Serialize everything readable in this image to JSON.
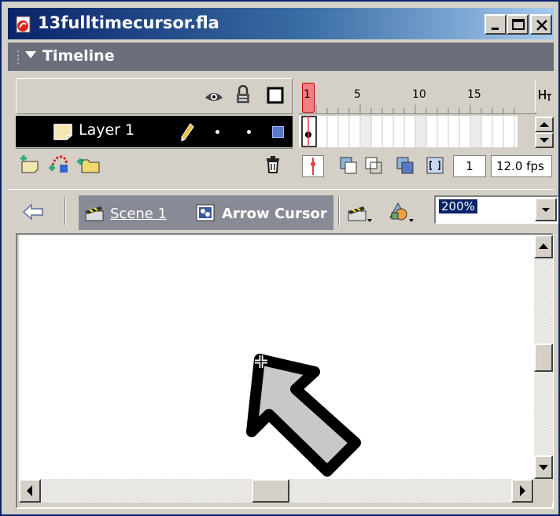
{
  "window": {
    "title": "13fulltimecursor.fla",
    "buttons": [
      "minimize",
      "maximize",
      "close"
    ]
  },
  "timeline": {
    "panel_title": "Timeline",
    "ruler_numbers": [
      "1",
      "5",
      "10",
      "15"
    ],
    "layer": {
      "name": "Layer 1"
    },
    "current_frame": "1",
    "frame_rate": "12.0 fps"
  },
  "editbar": {
    "scene_label": "Scene 1",
    "symbol_label": "Arrow Cursor",
    "zoom": "200%"
  },
  "colors": {
    "titlebar_start": "#0a246a",
    "panel_header": "#6b6f7c",
    "playhead": "#e04040",
    "layer_row_bg": "#000000",
    "arrow_fill": "#c8c8c8"
  },
  "icons": {
    "window_icon": "flash-file-icon",
    "eye": "eye-icon",
    "lock": "lock-icon",
    "outline": "outline-square-icon",
    "pencil": "pencil-icon",
    "trash": "trash-icon",
    "back": "back-arrow-icon",
    "scene": "scene-clapper-icon",
    "symbol": "movieclip-symbol-icon"
  }
}
